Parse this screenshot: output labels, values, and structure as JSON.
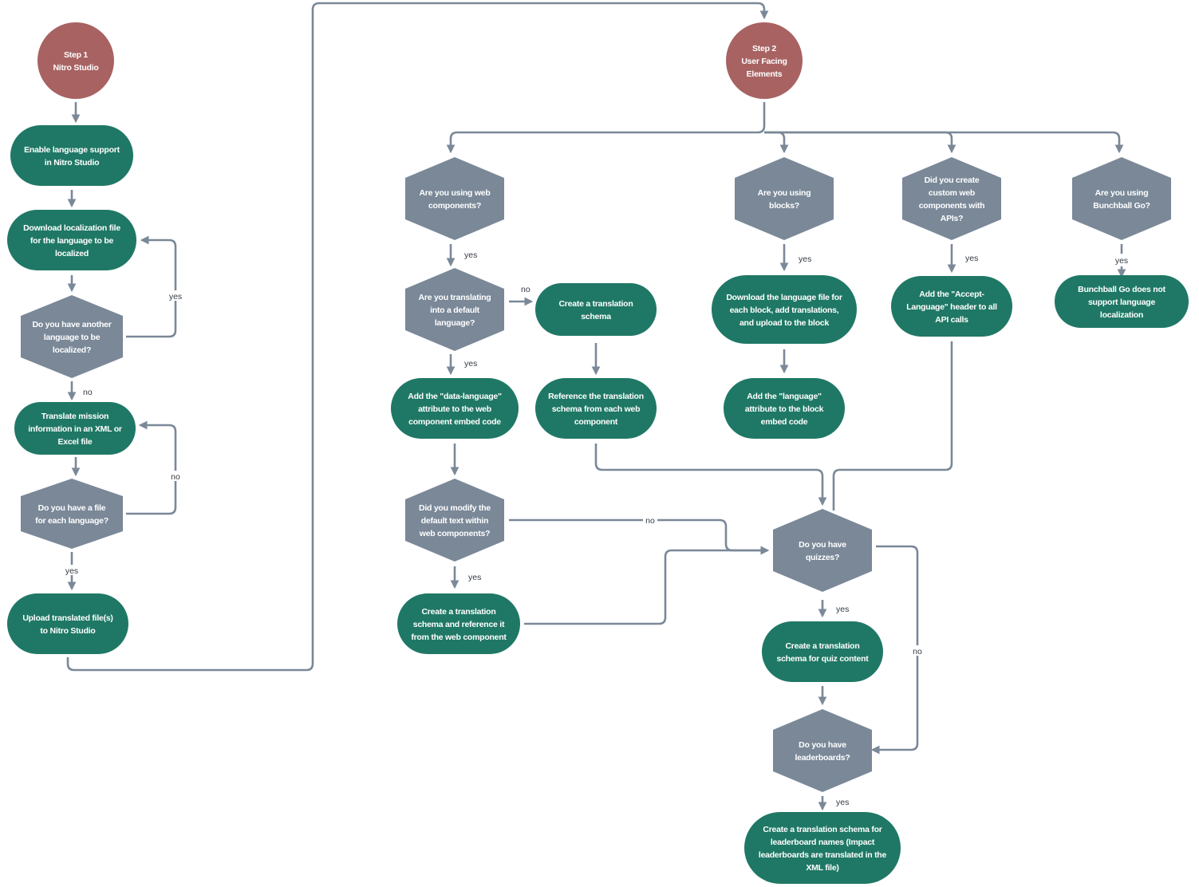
{
  "colors": {
    "start_circle": "#A86262",
    "process_pill": "#1F7865",
    "decision_hex": "#7A8898",
    "connector": "#7A8898",
    "text_on_shape": "#FFFFFF"
  },
  "nodes": [
    {
      "id": "step1",
      "kind": "start",
      "lines": [
        "Step 1",
        "Nitro Studio"
      ]
    },
    {
      "id": "enable",
      "kind": "process",
      "lines": [
        "Enable language support",
        "in Nitro Studio"
      ]
    },
    {
      "id": "download-loc",
      "kind": "process",
      "lines": [
        "Download localization file",
        "for the language to be",
        "localized"
      ]
    },
    {
      "id": "another-lang",
      "kind": "decision",
      "lines": [
        "Do you have another",
        "language to be",
        "localized?"
      ]
    },
    {
      "id": "translate-mission",
      "kind": "process",
      "lines": [
        "Translate mission",
        "information in an XML or",
        "Excel file"
      ]
    },
    {
      "id": "file-each",
      "kind": "decision",
      "lines": [
        "Do you have a file",
        "for each language?"
      ]
    },
    {
      "id": "upload",
      "kind": "process",
      "lines": [
        "Upload translated file(s)",
        "to Nitro Studio"
      ]
    },
    {
      "id": "step2",
      "kind": "start",
      "lines": [
        "Step 2",
        "User Facing",
        "Elements"
      ]
    },
    {
      "id": "web-components",
      "kind": "decision",
      "lines": [
        "Are you using web",
        "components?"
      ]
    },
    {
      "id": "default-lang",
      "kind": "decision",
      "lines": [
        "Are you translating",
        "into a default",
        "language?"
      ]
    },
    {
      "id": "create-schema",
      "kind": "process",
      "lines": [
        "Create a translation",
        "schema"
      ]
    },
    {
      "id": "data-language",
      "kind": "process",
      "lines": [
        "Add the \"data-language\"",
        "attribute to the web",
        "component embed code"
      ]
    },
    {
      "id": "reference-schema",
      "kind": "process",
      "lines": [
        "Reference the translation",
        "schema from each web",
        "component"
      ]
    },
    {
      "id": "modify-text",
      "kind": "decision",
      "lines": [
        "Did you modify the",
        "default text within",
        "web components?"
      ]
    },
    {
      "id": "create-ref-schema",
      "kind": "process",
      "lines": [
        "Create a translation",
        "schema and reference it",
        "from the web component"
      ]
    },
    {
      "id": "blocks",
      "kind": "decision",
      "lines": [
        "Are you using",
        "blocks?"
      ]
    },
    {
      "id": "download-block",
      "kind": "process",
      "lines": [
        "Download the language file for",
        "each block, add translations,",
        "and upload to the block"
      ]
    },
    {
      "id": "language-attr",
      "kind": "process",
      "lines": [
        "Add the \"language\"",
        "attribute to the block",
        "embed code"
      ]
    },
    {
      "id": "custom-apis",
      "kind": "decision",
      "lines": [
        "Did you create",
        "custom web",
        "components with",
        "APIs?"
      ]
    },
    {
      "id": "accept-language",
      "kind": "process",
      "lines": [
        "Add the \"Accept-",
        "Language\" header to all",
        "API calls"
      ]
    },
    {
      "id": "bunchball",
      "kind": "decision",
      "lines": [
        "Are you using",
        "Bunchball Go?"
      ]
    },
    {
      "id": "bunchball-no",
      "kind": "process",
      "lines": [
        "Bunchball Go does not",
        "support language",
        "localization"
      ]
    },
    {
      "id": "quizzes",
      "kind": "decision",
      "lines": [
        "Do you have",
        "quizzes?"
      ]
    },
    {
      "id": "quiz-schema",
      "kind": "process",
      "lines": [
        "Create a translation",
        "schema for quiz content"
      ]
    },
    {
      "id": "leaderboards",
      "kind": "decision",
      "lines": [
        "Do you have",
        "leaderboards?"
      ]
    },
    {
      "id": "leaderboard-schema",
      "kind": "process",
      "lines": [
        "Create a translation schema for",
        "leaderboard names (Impact",
        "leaderboards are translated in the",
        "XML file)"
      ]
    }
  ],
  "edge_labels": [
    "yes",
    "no",
    "no",
    "yes",
    "yes",
    "no",
    "yes",
    "no",
    "yes",
    "yes",
    "yes",
    "yes",
    "yes",
    "no",
    "yes"
  ]
}
